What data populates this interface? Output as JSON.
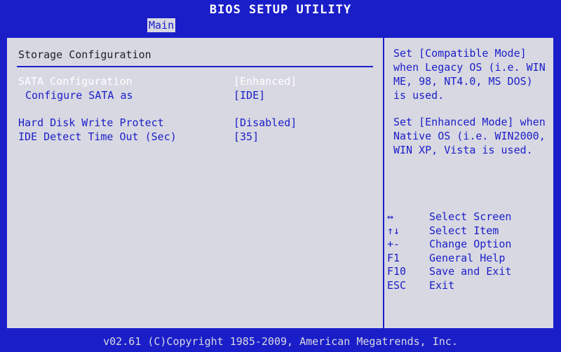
{
  "window": {
    "title": "BIOS SETUP UTILITY"
  },
  "tabs": [
    {
      "label": "Main",
      "active": true
    }
  ],
  "main": {
    "section_title": "Storage Configuration",
    "items": [
      {
        "label": "SATA Configuration",
        "value": "[Enhanced]",
        "selected": true
      },
      {
        "label": "Configure SATA as",
        "value": "[IDE]",
        "selected": false
      },
      {
        "label": "Hard Disk Write Protect",
        "value": "[Disabled]",
        "selected": false
      },
      {
        "label": "IDE Detect Time Out (Sec)",
        "value": "[35]",
        "selected": false
      }
    ]
  },
  "help": {
    "paragraphs": [
      "Set [Compatible Mode] when Legacy OS (i.e. WIN ME, 98, NT4.0, MS DOS) is used.",
      "Set [Enhanced Mode] when Native OS (i.e. WIN2000, WIN XP, Vista is used."
    ]
  },
  "keys": [
    {
      "key": "↔",
      "description": "Select Screen",
      "icon": "left-right-arrow-icon"
    },
    {
      "key": "↑↓",
      "description": "Select Item",
      "icon": "up-down-arrow-icon"
    },
    {
      "key": "+-",
      "description": "Change Option",
      "icon": "plus-minus-icon"
    },
    {
      "key": "F1",
      "description": "General Help"
    },
    {
      "key": "F10",
      "description": "Save and Exit"
    },
    {
      "key": "ESC",
      "description": "Exit"
    }
  ],
  "status": {
    "copyright": "v02.61 (C)Copyright 1985-2009, American Megatrends, Inc."
  },
  "colors": {
    "blue": "#1a1ec8",
    "panel": "#d8d8e2",
    "selected_text": "#ffffff"
  }
}
